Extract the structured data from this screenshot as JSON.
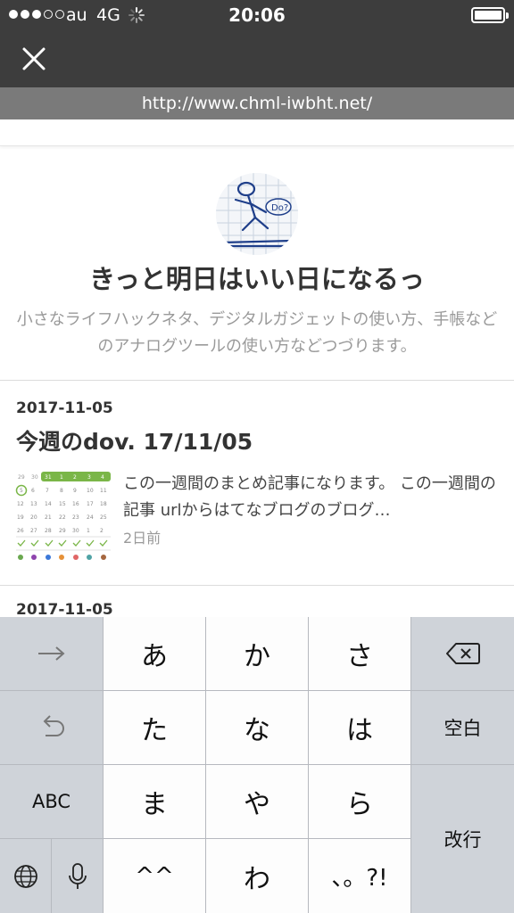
{
  "status_bar": {
    "carrier": "au",
    "network": "4G",
    "time": "20:06"
  },
  "browser": {
    "url": "http://www.chml-iwbht.net/"
  },
  "blog": {
    "title": "きっと明日はいい日になるっ",
    "description": "小さなライフハックネタ、デジタルガジェットの使い方、手帳などのアナログツールの使い方などつづります。"
  },
  "entries": [
    {
      "date": "2017-11-05",
      "title": "今週のdov. 17/11/05",
      "excerpt": "この一週間のまとめ記事になります。 この一週間の記事 urlからはてなブログのブログ…",
      "time_ago": "2日前"
    },
    {
      "date": "2017-11-05"
    }
  ],
  "keyboard": {
    "keys": {
      "a": "あ",
      "ka": "か",
      "sa": "さ",
      "ta": "た",
      "na": "な",
      "ha": "は",
      "ma": "ま",
      "ya": "や",
      "ra": "ら",
      "kaomoji": "^^",
      "wa": "わ",
      "punct": "、。?!",
      "abc": "ABC",
      "space": "空白",
      "enter": "改行"
    }
  },
  "icons": {
    "close": "close-icon",
    "next": "arrow-right-icon",
    "undo": "undo-icon",
    "backspace": "backspace-icon",
    "globe": "globe-icon",
    "mic": "microphone-icon"
  },
  "colors": {
    "header_bg": "#3d3d3d",
    "url_bar_bg": "#7a7a7a",
    "keyboard_bg": "#b6b9bf",
    "calendar_green": "#7ab648"
  }
}
